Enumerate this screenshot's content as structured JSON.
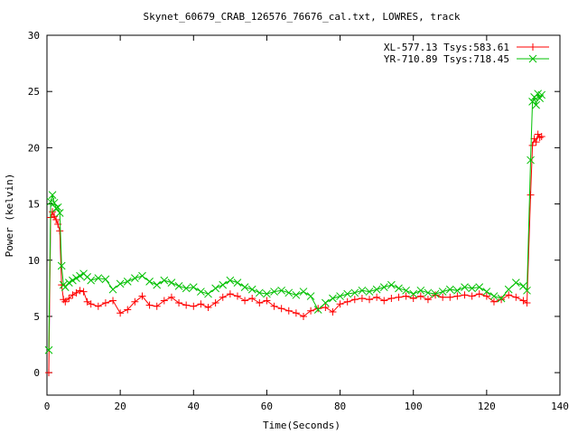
{
  "chart_data": {
    "type": "scatter",
    "title": "Skynet_60679_CRAB_126576_76676_cal.txt, LOWRES, track",
    "xlabel": "Time(Seconds)",
    "ylabel": "Power (kelvin)",
    "xlim": [
      0,
      140
    ],
    "ylim": [
      -2,
      30
    ],
    "xticks": [
      "0",
      "20",
      "40",
      "60",
      "80",
      "100",
      "120",
      "140"
    ],
    "yticks": [
      "0",
      "5",
      "10",
      "15",
      "20",
      "25",
      "30"
    ],
    "legend_position": "top-right",
    "series": [
      {
        "name": "XL-577.13 Tsys:583.61",
        "color": "#ff0000",
        "marker": "plus",
        "points": [
          [
            0.5,
            0
          ],
          [
            1.0,
            13.8
          ],
          [
            1.5,
            14.3
          ],
          [
            2.0,
            13.9
          ],
          [
            2.5,
            13.6
          ],
          [
            3.0,
            13.2
          ],
          [
            3.5,
            12.6
          ],
          [
            4.0,
            7.8
          ],
          [
            4.5,
            6.5
          ],
          [
            5,
            6.3
          ],
          [
            6,
            6.6
          ],
          [
            7,
            6.9
          ],
          [
            8,
            7.1
          ],
          [
            9,
            7.3
          ],
          [
            10,
            7.2
          ],
          [
            11,
            6.3
          ],
          [
            12,
            6.1
          ],
          [
            14,
            5.9
          ],
          [
            16,
            6.2
          ],
          [
            18,
            6.4
          ],
          [
            20,
            5.3
          ],
          [
            22,
            5.6
          ],
          [
            24,
            6.3
          ],
          [
            26,
            6.8
          ],
          [
            28,
            6.0
          ],
          [
            30,
            5.9
          ],
          [
            32,
            6.4
          ],
          [
            34,
            6.7
          ],
          [
            36,
            6.2
          ],
          [
            38,
            6.0
          ],
          [
            40,
            5.9
          ],
          [
            42,
            6.1
          ],
          [
            44,
            5.8
          ],
          [
            46,
            6.2
          ],
          [
            48,
            6.7
          ],
          [
            50,
            7.0
          ],
          [
            52,
            6.8
          ],
          [
            54,
            6.4
          ],
          [
            56,
            6.6
          ],
          [
            58,
            6.2
          ],
          [
            60,
            6.4
          ],
          [
            62,
            5.9
          ],
          [
            64,
            5.7
          ],
          [
            66,
            5.5
          ],
          [
            68,
            5.3
          ],
          [
            70,
            5.0
          ],
          [
            72,
            5.5
          ],
          [
            74,
            5.7
          ],
          [
            76,
            5.8
          ],
          [
            78,
            5.4
          ],
          [
            80,
            6.1
          ],
          [
            82,
            6.3
          ],
          [
            84,
            6.5
          ],
          [
            86,
            6.6
          ],
          [
            88,
            6.5
          ],
          [
            90,
            6.7
          ],
          [
            92,
            6.4
          ],
          [
            94,
            6.6
          ],
          [
            96,
            6.7
          ],
          [
            98,
            6.8
          ],
          [
            100,
            6.6
          ],
          [
            102,
            6.8
          ],
          [
            104,
            6.5
          ],
          [
            106,
            6.9
          ],
          [
            108,
            6.7
          ],
          [
            110,
            6.7
          ],
          [
            112,
            6.8
          ],
          [
            114,
            6.9
          ],
          [
            116,
            6.8
          ],
          [
            118,
            7.0
          ],
          [
            120,
            6.8
          ],
          [
            122,
            6.3
          ],
          [
            124,
            6.5
          ],
          [
            126,
            6.9
          ],
          [
            128,
            6.7
          ],
          [
            130,
            6.4
          ],
          [
            131,
            6.2
          ],
          [
            132,
            15.8
          ],
          [
            132.5,
            20.2
          ],
          [
            133,
            20.8
          ],
          [
            133.5,
            20.5
          ],
          [
            134,
            21.2
          ],
          [
            134.5,
            20.9
          ],
          [
            135,
            21.0
          ]
        ]
      },
      {
        "name": "YR-710.89 Tsys:718.45",
        "color": "#00c000",
        "marker": "cross",
        "points": [
          [
            0.5,
            2.0
          ],
          [
            1.0,
            15.2
          ],
          [
            1.5,
            15.8
          ],
          [
            2.0,
            15.1
          ],
          [
            2.5,
            14.6
          ],
          [
            3.0,
            14.7
          ],
          [
            3.5,
            14.2
          ],
          [
            4.0,
            9.5
          ],
          [
            4.5,
            7.8
          ],
          [
            5,
            7.6
          ],
          [
            6,
            8.0
          ],
          [
            7,
            8.2
          ],
          [
            8,
            8.4
          ],
          [
            9,
            8.6
          ],
          [
            10,
            8.8
          ],
          [
            11,
            8.5
          ],
          [
            12,
            8.2
          ],
          [
            14,
            8.4
          ],
          [
            16,
            8.3
          ],
          [
            18,
            7.4
          ],
          [
            20,
            7.9
          ],
          [
            22,
            8.1
          ],
          [
            24,
            8.4
          ],
          [
            26,
            8.6
          ],
          [
            28,
            8.1
          ],
          [
            30,
            7.8
          ],
          [
            32,
            8.2
          ],
          [
            34,
            8.0
          ],
          [
            36,
            7.7
          ],
          [
            38,
            7.5
          ],
          [
            40,
            7.6
          ],
          [
            42,
            7.2
          ],
          [
            44,
            7.0
          ],
          [
            46,
            7.5
          ],
          [
            48,
            7.8
          ],
          [
            50,
            8.2
          ],
          [
            52,
            8.0
          ],
          [
            54,
            7.6
          ],
          [
            56,
            7.4
          ],
          [
            58,
            7.1
          ],
          [
            60,
            7.0
          ],
          [
            62,
            7.2
          ],
          [
            64,
            7.3
          ],
          [
            66,
            7.1
          ],
          [
            68,
            6.9
          ],
          [
            70,
            7.2
          ],
          [
            72,
            6.8
          ],
          [
            74,
            5.6
          ],
          [
            76,
            6.2
          ],
          [
            78,
            6.6
          ],
          [
            80,
            6.8
          ],
          [
            82,
            7.0
          ],
          [
            84,
            7.1
          ],
          [
            86,
            7.3
          ],
          [
            88,
            7.2
          ],
          [
            90,
            7.4
          ],
          [
            92,
            7.6
          ],
          [
            94,
            7.8
          ],
          [
            96,
            7.5
          ],
          [
            98,
            7.3
          ],
          [
            100,
            7.0
          ],
          [
            102,
            7.3
          ],
          [
            104,
            7.1
          ],
          [
            106,
            7.0
          ],
          [
            108,
            7.2
          ],
          [
            110,
            7.4
          ],
          [
            112,
            7.3
          ],
          [
            114,
            7.6
          ],
          [
            116,
            7.5
          ],
          [
            118,
            7.6
          ],
          [
            120,
            7.2
          ],
          [
            122,
            6.8
          ],
          [
            124,
            6.6
          ],
          [
            126,
            7.4
          ],
          [
            128,
            8.0
          ],
          [
            130,
            7.7
          ],
          [
            131,
            7.3
          ],
          [
            132,
            18.9
          ],
          [
            132.5,
            24.1
          ],
          [
            133,
            24.5
          ],
          [
            133.5,
            23.8
          ],
          [
            134,
            24.8
          ],
          [
            134.5,
            24.4
          ],
          [
            135,
            24.7
          ]
        ]
      }
    ]
  }
}
